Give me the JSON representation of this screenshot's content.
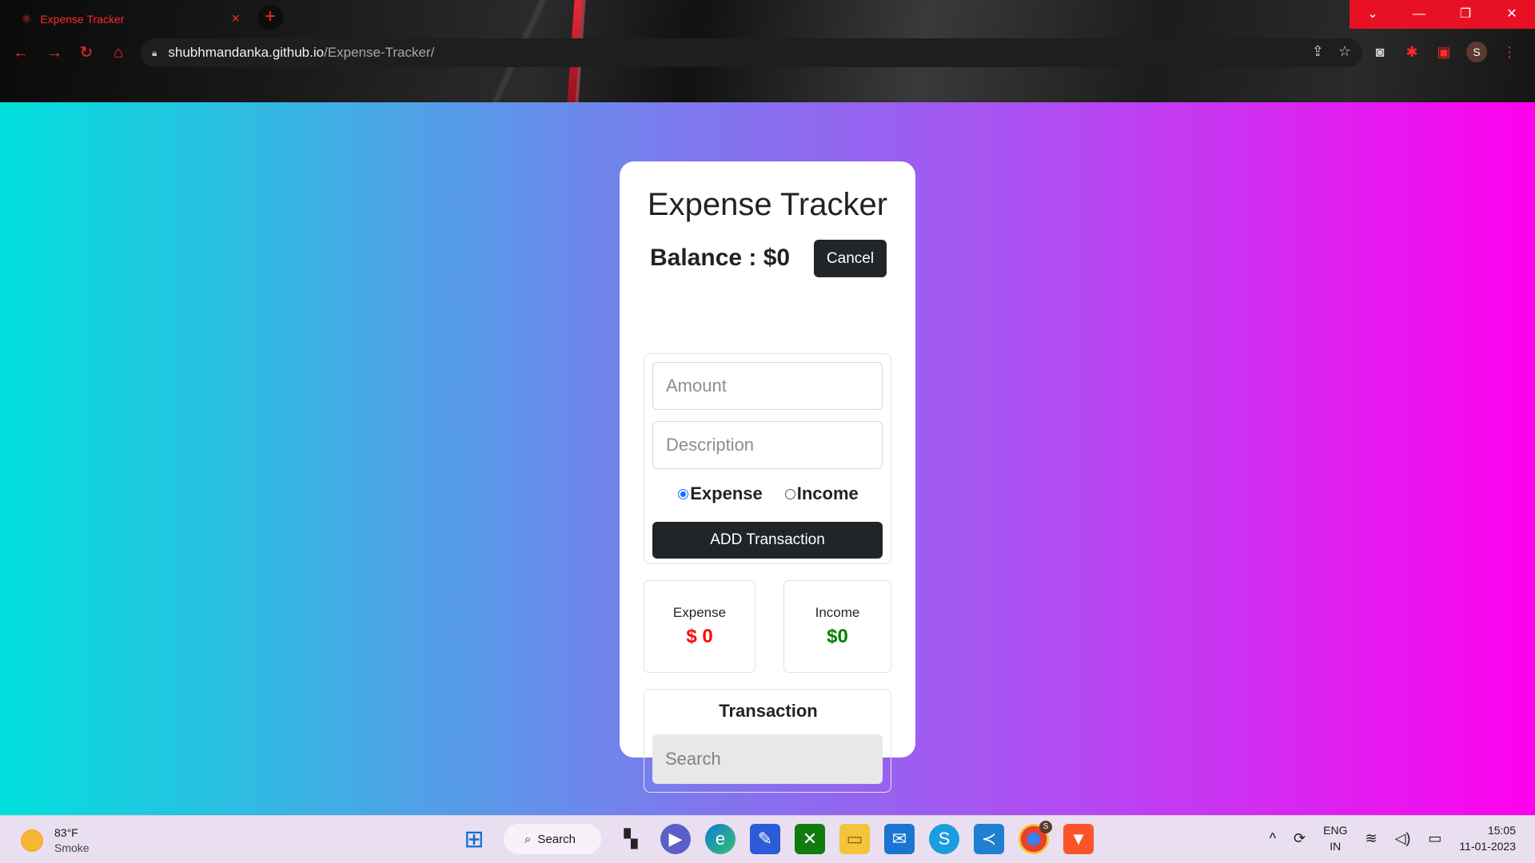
{
  "browser": {
    "tab_title": "Expense Tracker",
    "tab_close": "×",
    "new_tab": "+",
    "url_host": "shubhmandanka.github.io",
    "url_path": "/Expense-Tracker/",
    "profile_initial": "S",
    "window_controls": [
      "⌄",
      "—",
      "❐",
      "✕"
    ]
  },
  "app": {
    "title": "Expense Tracker",
    "balance_label": "Balance : $0",
    "cancel_label": "Cancel",
    "amount_placeholder": "Amount",
    "description_placeholder": "Description",
    "radio_expense": "Expense",
    "radio_income": "Income",
    "selected_type": "expense",
    "add_button": "ADD Transaction",
    "expense_label": "Expense",
    "expense_value": "$ 0",
    "income_label": "Income",
    "income_value": "$0",
    "transactions_heading": "Transaction",
    "search_placeholder": "Search",
    "colors": {
      "expense": "#ff0000",
      "income": "#008000",
      "dark_button": "#212529",
      "gradient_start": "#00e0dc",
      "gradient_end": "#ff00ee"
    }
  },
  "taskbar": {
    "weather_temp": "83°F",
    "weather_desc": "Smoke",
    "search_label": "Search",
    "lang_top": "ENG",
    "lang_bottom": "IN",
    "time": "15:05",
    "date": "11-01-2023",
    "chrome_badge": "S"
  }
}
